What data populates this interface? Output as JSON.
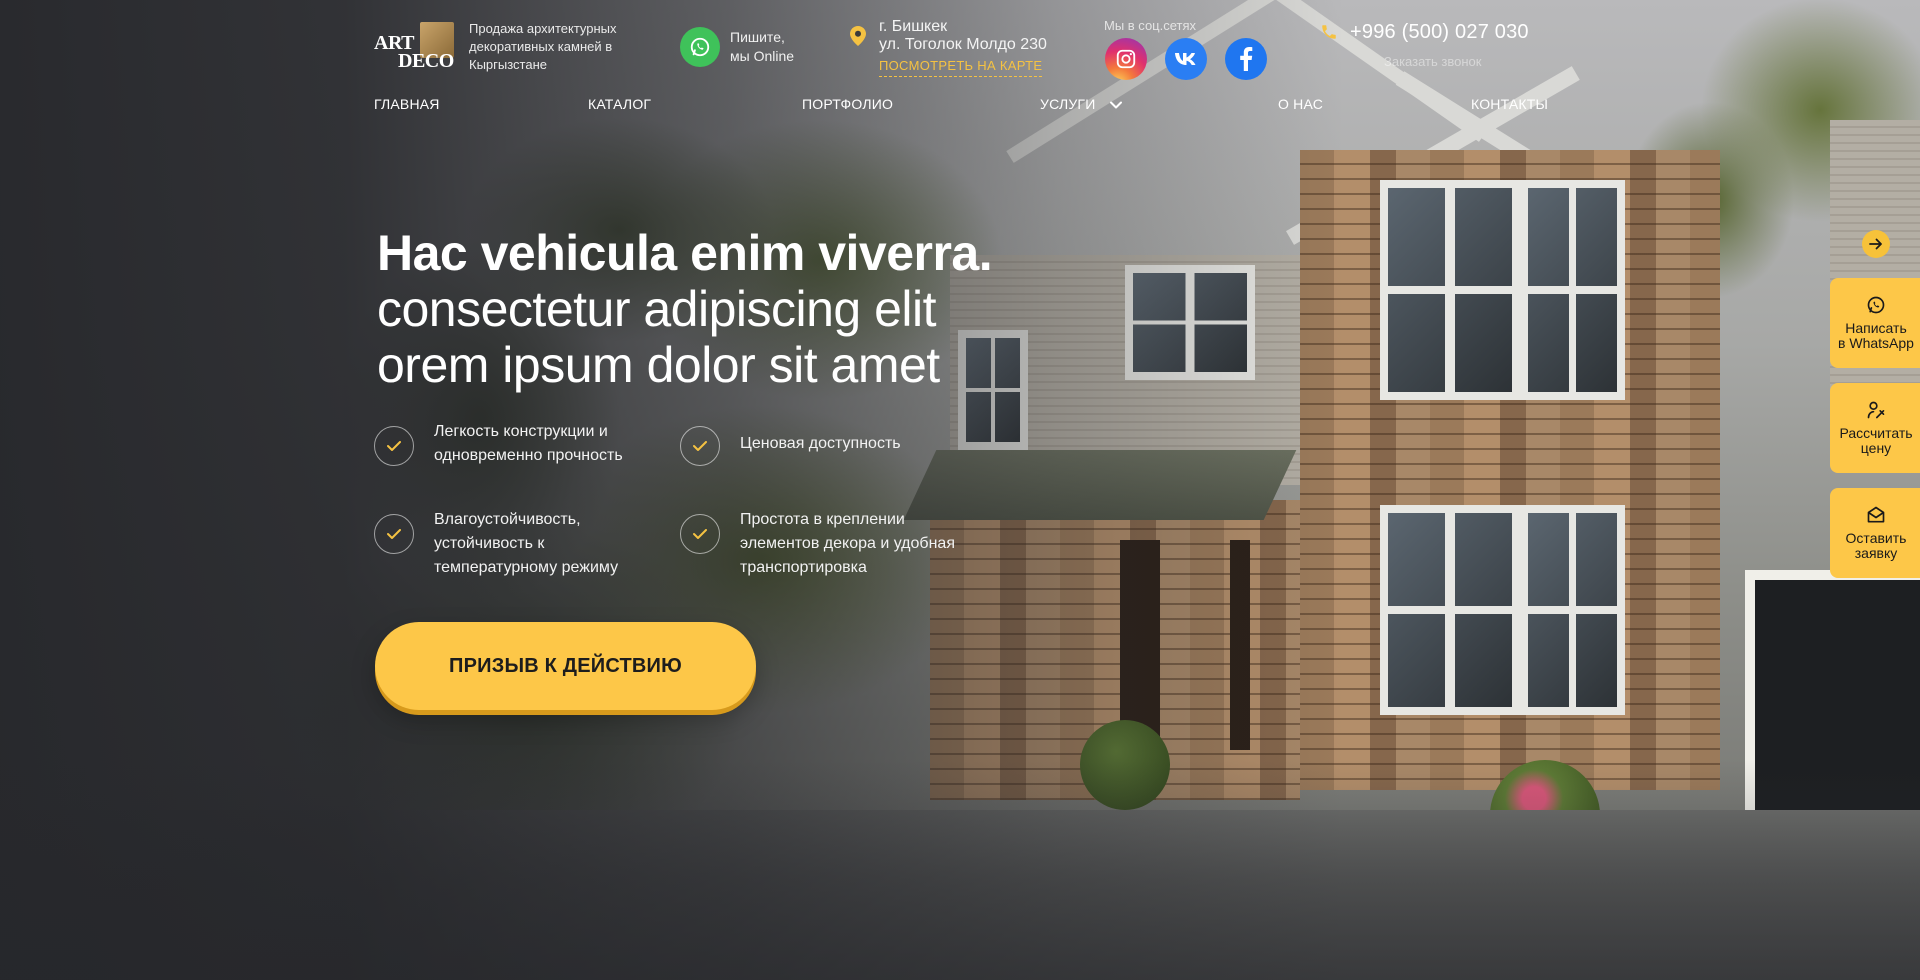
{
  "brand": {
    "logo_line1": "ART",
    "logo_line2": "DECO",
    "tagline": "Продажа архитектурных декоративных камней в Кыргызстане"
  },
  "contacts": {
    "whatsapp_text_1": "Пишите,",
    "whatsapp_text_2": "мы Online",
    "city": "г. Бишкек",
    "street": "ул. Тоголок Молдо 230",
    "map_link": "ПОСМОТРЕТЬ НА КАРТЕ",
    "social_label": "Мы в соц.сетях",
    "phone": "+996 (500) 027 030",
    "callback": "Заказать звонок"
  },
  "nav": {
    "items": [
      {
        "label": "ГЛАВНАЯ"
      },
      {
        "label": "КАТАЛОГ"
      },
      {
        "label": "ПОРТФОЛИО"
      },
      {
        "label": "УСЛУГИ"
      },
      {
        "label": "О НАС"
      },
      {
        "label": "КОНТАКТЫ"
      }
    ]
  },
  "hero": {
    "title_bold": "Hac vehicula enim viverra.",
    "title_line2": "consectetur adipiscing elit",
    "title_line3": "orem ipsum dolor sit amet",
    "features": [
      {
        "text": "Легкость конструкции и одновременно прочность"
      },
      {
        "text": "Ценовая доступность"
      },
      {
        "text": "Влагоустойчивость, устойчивость к температурному режиму"
      },
      {
        "text": "Простота в креплении элементов декора и удобная транспортировка"
      }
    ],
    "cta": "ПРИЗЫВ К ДЕЙСТВИЮ"
  },
  "side_panel": {
    "whatsapp": {
      "line1": "Написать",
      "line2": "в WhatsApp"
    },
    "calculate": {
      "line1": "Рассчитать",
      "line2": "цену"
    },
    "request": {
      "line1": "Оставить",
      "line2": "заявку"
    }
  },
  "colors": {
    "accent": "#fdc748",
    "whatsapp_green": "#3fc25a",
    "vk_blue": "#2a7ef3",
    "facebook_blue": "#1f76f0",
    "dark_overlay": "#26272b"
  }
}
